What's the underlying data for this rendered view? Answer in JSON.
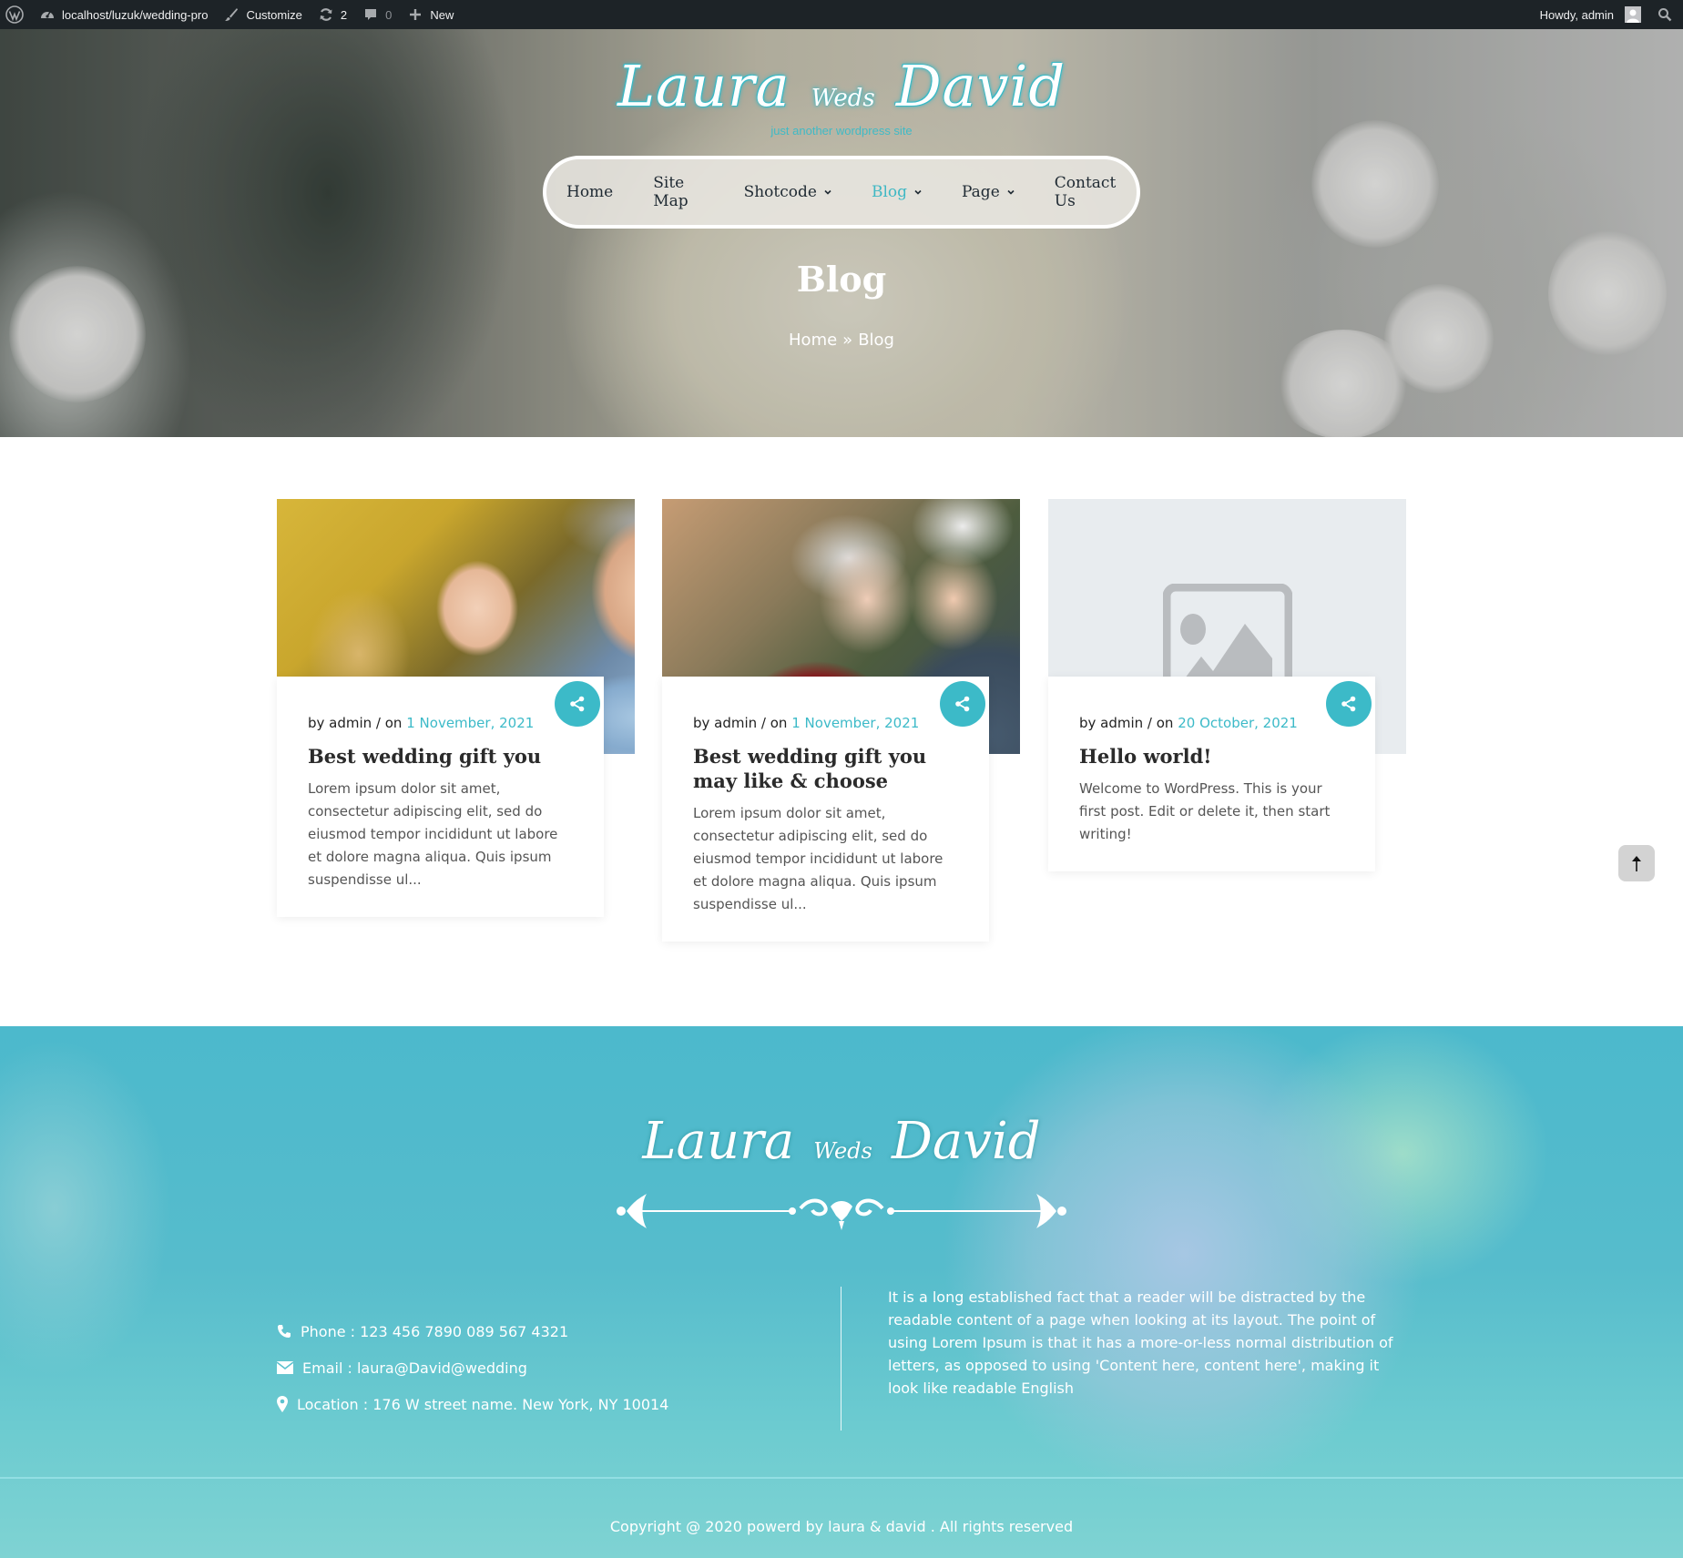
{
  "adminbar": {
    "site_url": "localhost/luzuk/wedding-pro",
    "customize": "Customize",
    "updates_count": "2",
    "comments_count": "0",
    "new": "New",
    "greeting": "Howdy, admin"
  },
  "header": {
    "logo_first": "Laura",
    "logo_middle": "Weds",
    "logo_last": "David",
    "tagline": "just another wordpress site",
    "accent_color": "#3cbac8"
  },
  "nav": {
    "items": [
      {
        "label": "Home",
        "has_dropdown": false,
        "active": false
      },
      {
        "label": "Site Map",
        "has_dropdown": false,
        "active": false
      },
      {
        "label": "Shotcode",
        "has_dropdown": true,
        "active": false
      },
      {
        "label": "Blog",
        "has_dropdown": true,
        "active": true
      },
      {
        "label": "Page",
        "has_dropdown": true,
        "active": false
      },
      {
        "label": "Contact Us",
        "has_dropdown": false,
        "active": false
      }
    ]
  },
  "page": {
    "title": "Blog",
    "breadcrumb": [
      "Home",
      "»",
      "Blog"
    ]
  },
  "posts": [
    {
      "author_prefix": "by admin / on",
      "date": "1 November, 2021",
      "title": "Best wedding gift you",
      "excerpt": "Lorem ipsum dolor sit amet, consectetur adipiscing elit, sed do eiusmod tempor incididunt ut labore et dolore magna aliqua. Quis ipsum suspendisse ul..."
    },
    {
      "author_prefix": "by admin / on",
      "date": "1 November, 2021",
      "title": "Best wedding gift you may like & choose",
      "excerpt": "Lorem ipsum dolor sit amet, consectetur adipiscing elit, sed do eiusmod tempor incididunt ut labore et dolore magna aliqua. Quis ipsum suspendisse ul..."
    },
    {
      "author_prefix": "by admin / on",
      "date": "20 October, 2021",
      "title": "Hello world!",
      "excerpt": "Welcome to WordPress. This is your first post. Edit or delete it, then start writing!"
    }
  ],
  "footer": {
    "logo_first": "Laura",
    "logo_middle": "Weds",
    "logo_last": "David",
    "phone": "Phone : 123 456 7890 089 567 4321",
    "email": "Email : laura@David@wedding",
    "location": "Location : 176 W street name. New York, NY 10014",
    "about": "It is a long established fact that a reader will be distracted by the readable content of a page when looking at its layout. The point of using Lorem Ipsum is that it has a more-or-less normal distribution of letters, as opposed to using 'Content here, content here', making it look like readable English",
    "copyright": "Copyright @ 2020 powerd by laura & david . All rights reserved"
  }
}
